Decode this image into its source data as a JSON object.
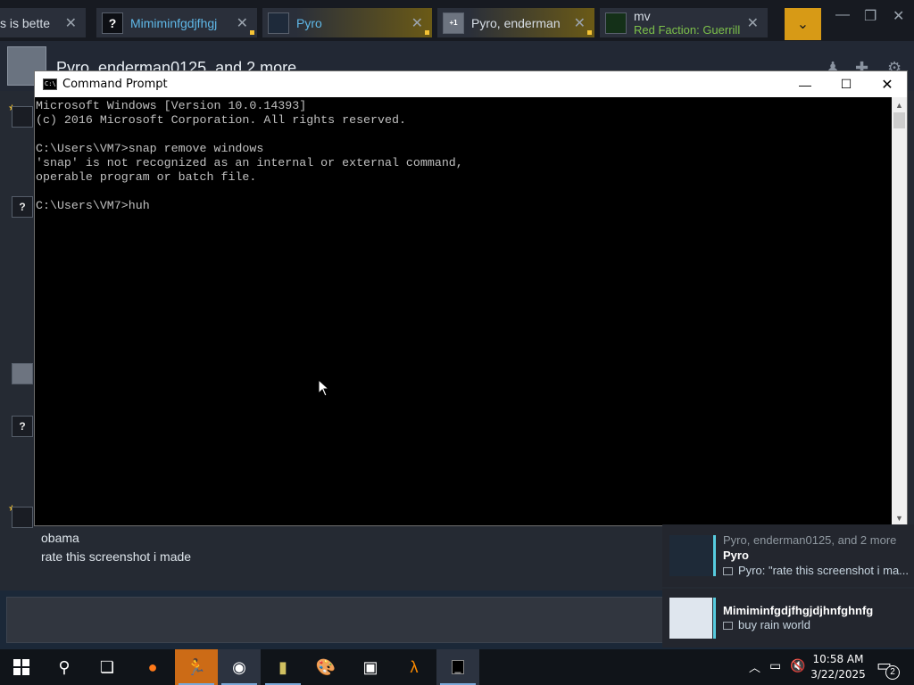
{
  "steam": {
    "tabs": [
      {
        "label": "s is bette",
        "avatar": ""
      },
      {
        "label": "Mimiminfgdjfhgj",
        "avatar": "?"
      },
      {
        "label": "Pyro",
        "avatar": ""
      },
      {
        "label": "Pyro, enderman",
        "avatar": "+1"
      },
      {
        "label": "mv",
        "sub": "Red Faction: Guerrill",
        "avatar": ""
      }
    ],
    "header_title": "Pyro, enderman0125, and 2 more",
    "unknown_avatar": "?",
    "messages": [
      "obama",
      "rate this screenshot i made"
    ]
  },
  "cmd": {
    "title": "Command Prompt",
    "icon_text": "C:\\",
    "lines": [
      "Microsoft Windows [Version 10.0.14393]",
      "(c) 2016 Microsoft Corporation. All rights reserved.",
      "",
      "C:\\Users\\VM7>snap remove windows",
      "'snap' is not recognized as an internal or external command,",
      "operable program or batch file.",
      "",
      "C:\\Users\\VM7>huh"
    ]
  },
  "notifications": [
    {
      "header": "Pyro, enderman0125, and 2 more",
      "name": "Pyro",
      "text": "Pyro: \"rate this screenshot i ma..."
    },
    {
      "name": "Mimiminfgdjfhgjdjhnfghnfg",
      "text": "buy rain world"
    }
  ],
  "taskbar": {
    "time": "10:58 AM",
    "date": "3/22/2025",
    "notification_count": "2"
  },
  "colors": {
    "steam_bg": "#1b2838",
    "accent_gold": "#d79a16",
    "link_blue": "#57cbde",
    "taskbar": "#101419"
  }
}
